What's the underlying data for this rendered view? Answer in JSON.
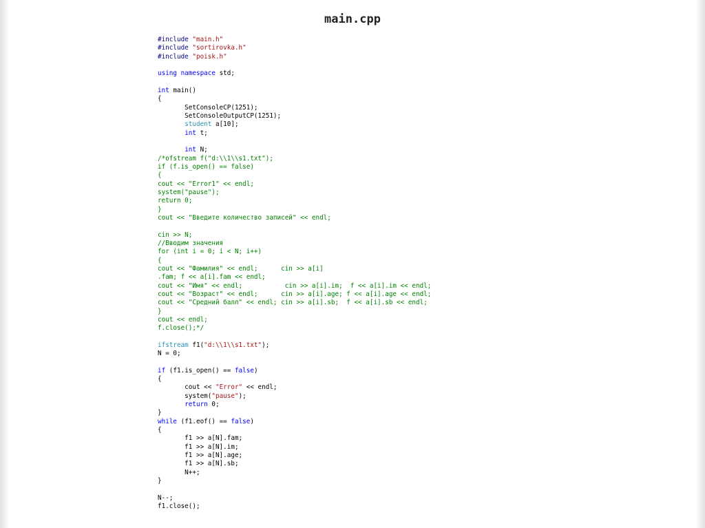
{
  "title": "main.cpp",
  "code_lines": [
    [
      {
        "t": "#include ",
        "c": "pp"
      },
      {
        "t": "\"main.h\"",
        "c": "str"
      }
    ],
    [
      {
        "t": "#include ",
        "c": "pp"
      },
      {
        "t": "\"sortirovka.h\"",
        "c": "str"
      }
    ],
    [
      {
        "t": "#include ",
        "c": "pp"
      },
      {
        "t": "\"poisk.h\"",
        "c": "str"
      }
    ],
    [],
    [
      {
        "t": "using namespace",
        "c": "kw"
      },
      {
        "t": " std;"
      }
    ],
    [],
    [
      {
        "t": "int",
        "c": "kw"
      },
      {
        "t": " main()"
      }
    ],
    [
      {
        "t": "{"
      }
    ],
    [
      {
        "t": "       SetConsoleCP(1251);"
      }
    ],
    [
      {
        "t": "       SetConsoleOutputCP(1251);"
      }
    ],
    [
      {
        "t": "       "
      },
      {
        "t": "student",
        "c": "ty"
      },
      {
        "t": " a[10];"
      }
    ],
    [
      {
        "t": "       "
      },
      {
        "t": "int",
        "c": "kw"
      },
      {
        "t": " t;"
      }
    ],
    [],
    [
      {
        "t": "       "
      },
      {
        "t": "int",
        "c": "kw"
      },
      {
        "t": " N;"
      }
    ],
    [
      {
        "t": "/*ofstream f(\"d:\\\\1\\\\s1.txt\");",
        "c": "cm"
      }
    ],
    [
      {
        "t": "if (f.is_open() == false)",
        "c": "cm"
      }
    ],
    [
      {
        "t": "{",
        "c": "cm"
      }
    ],
    [
      {
        "t": "cout << \"Error1\" << endl;",
        "c": "cm"
      }
    ],
    [
      {
        "t": "system(\"pause\");",
        "c": "cm"
      }
    ],
    [
      {
        "t": "return 0;",
        "c": "cm"
      }
    ],
    [
      {
        "t": "}",
        "c": "cm"
      }
    ],
    [
      {
        "t": "cout << \"Введите количество записей\" << endl;",
        "c": "cm"
      }
    ],
    [],
    [
      {
        "t": "cin >> N;",
        "c": "cm"
      }
    ],
    [
      {
        "t": "//Вводим значения",
        "c": "cm"
      }
    ],
    [
      {
        "t": "for (int i = 0; i < N; i++)",
        "c": "cm"
      }
    ],
    [
      {
        "t": "{",
        "c": "cm"
      }
    ],
    [
      {
        "t": "cout << \"Фамилия\" << endl;      cin >> a[i]",
        "c": "cm"
      }
    ],
    [
      {
        "t": ".fam; f << a[i].fam << endl;",
        "c": "cm"
      }
    ],
    [
      {
        "t": "cout << \"Имя\" << endl;           cin >> a[i].im;  f << a[i].im << endl;",
        "c": "cm"
      }
    ],
    [
      {
        "t": "cout << \"Возраст\" << endl;      cin >> a[i].age; f << a[i].age << endl;",
        "c": "cm"
      }
    ],
    [
      {
        "t": "cout << \"Средний балл\" << endl; cin >> a[i].sb;  f << a[i].sb << endl;",
        "c": "cm"
      }
    ],
    [
      {
        "t": "}",
        "c": "cm"
      }
    ],
    [
      {
        "t": "cout << endl;",
        "c": "cm"
      }
    ],
    [
      {
        "t": "f.close();*/",
        "c": "cm"
      }
    ],
    [],
    [
      {
        "t": "ifstream",
        "c": "ty"
      },
      {
        "t": " f1("
      },
      {
        "t": "\"d:\\\\1\\\\s1.txt\"",
        "c": "str"
      },
      {
        "t": ");"
      }
    ],
    [
      {
        "t": "N = 0;"
      }
    ],
    [],
    [
      {
        "t": "if",
        "c": "kw"
      },
      {
        "t": " (f1.is_open() == "
      },
      {
        "t": "false",
        "c": "kw"
      },
      {
        "t": ")"
      }
    ],
    [
      {
        "t": "{"
      }
    ],
    [
      {
        "t": "       cout << "
      },
      {
        "t": "\"Error\"",
        "c": "str"
      },
      {
        "t": " << endl;"
      }
    ],
    [
      {
        "t": "       system("
      },
      {
        "t": "\"pause\"",
        "c": "str"
      },
      {
        "t": ");"
      }
    ],
    [
      {
        "t": "       "
      },
      {
        "t": "return",
        "c": "kw"
      },
      {
        "t": " 0;"
      }
    ],
    [
      {
        "t": "}"
      }
    ],
    [
      {
        "t": "while",
        "c": "kw"
      },
      {
        "t": " (f1.eof() == "
      },
      {
        "t": "false",
        "c": "kw"
      },
      {
        "t": ")"
      }
    ],
    [
      {
        "t": "{"
      }
    ],
    [
      {
        "t": "       f1 >> a[N].fam;"
      }
    ],
    [
      {
        "t": "       f1 >> a[N].im;"
      }
    ],
    [
      {
        "t": "       f1 >> a[N].age;"
      }
    ],
    [
      {
        "t": "       f1 >> a[N].sb;"
      }
    ],
    [
      {
        "t": "       N++;"
      }
    ],
    [
      {
        "t": "}"
      }
    ],
    [],
    [
      {
        "t": "N--;"
      }
    ],
    [
      {
        "t": "f1.close();"
      }
    ]
  ]
}
